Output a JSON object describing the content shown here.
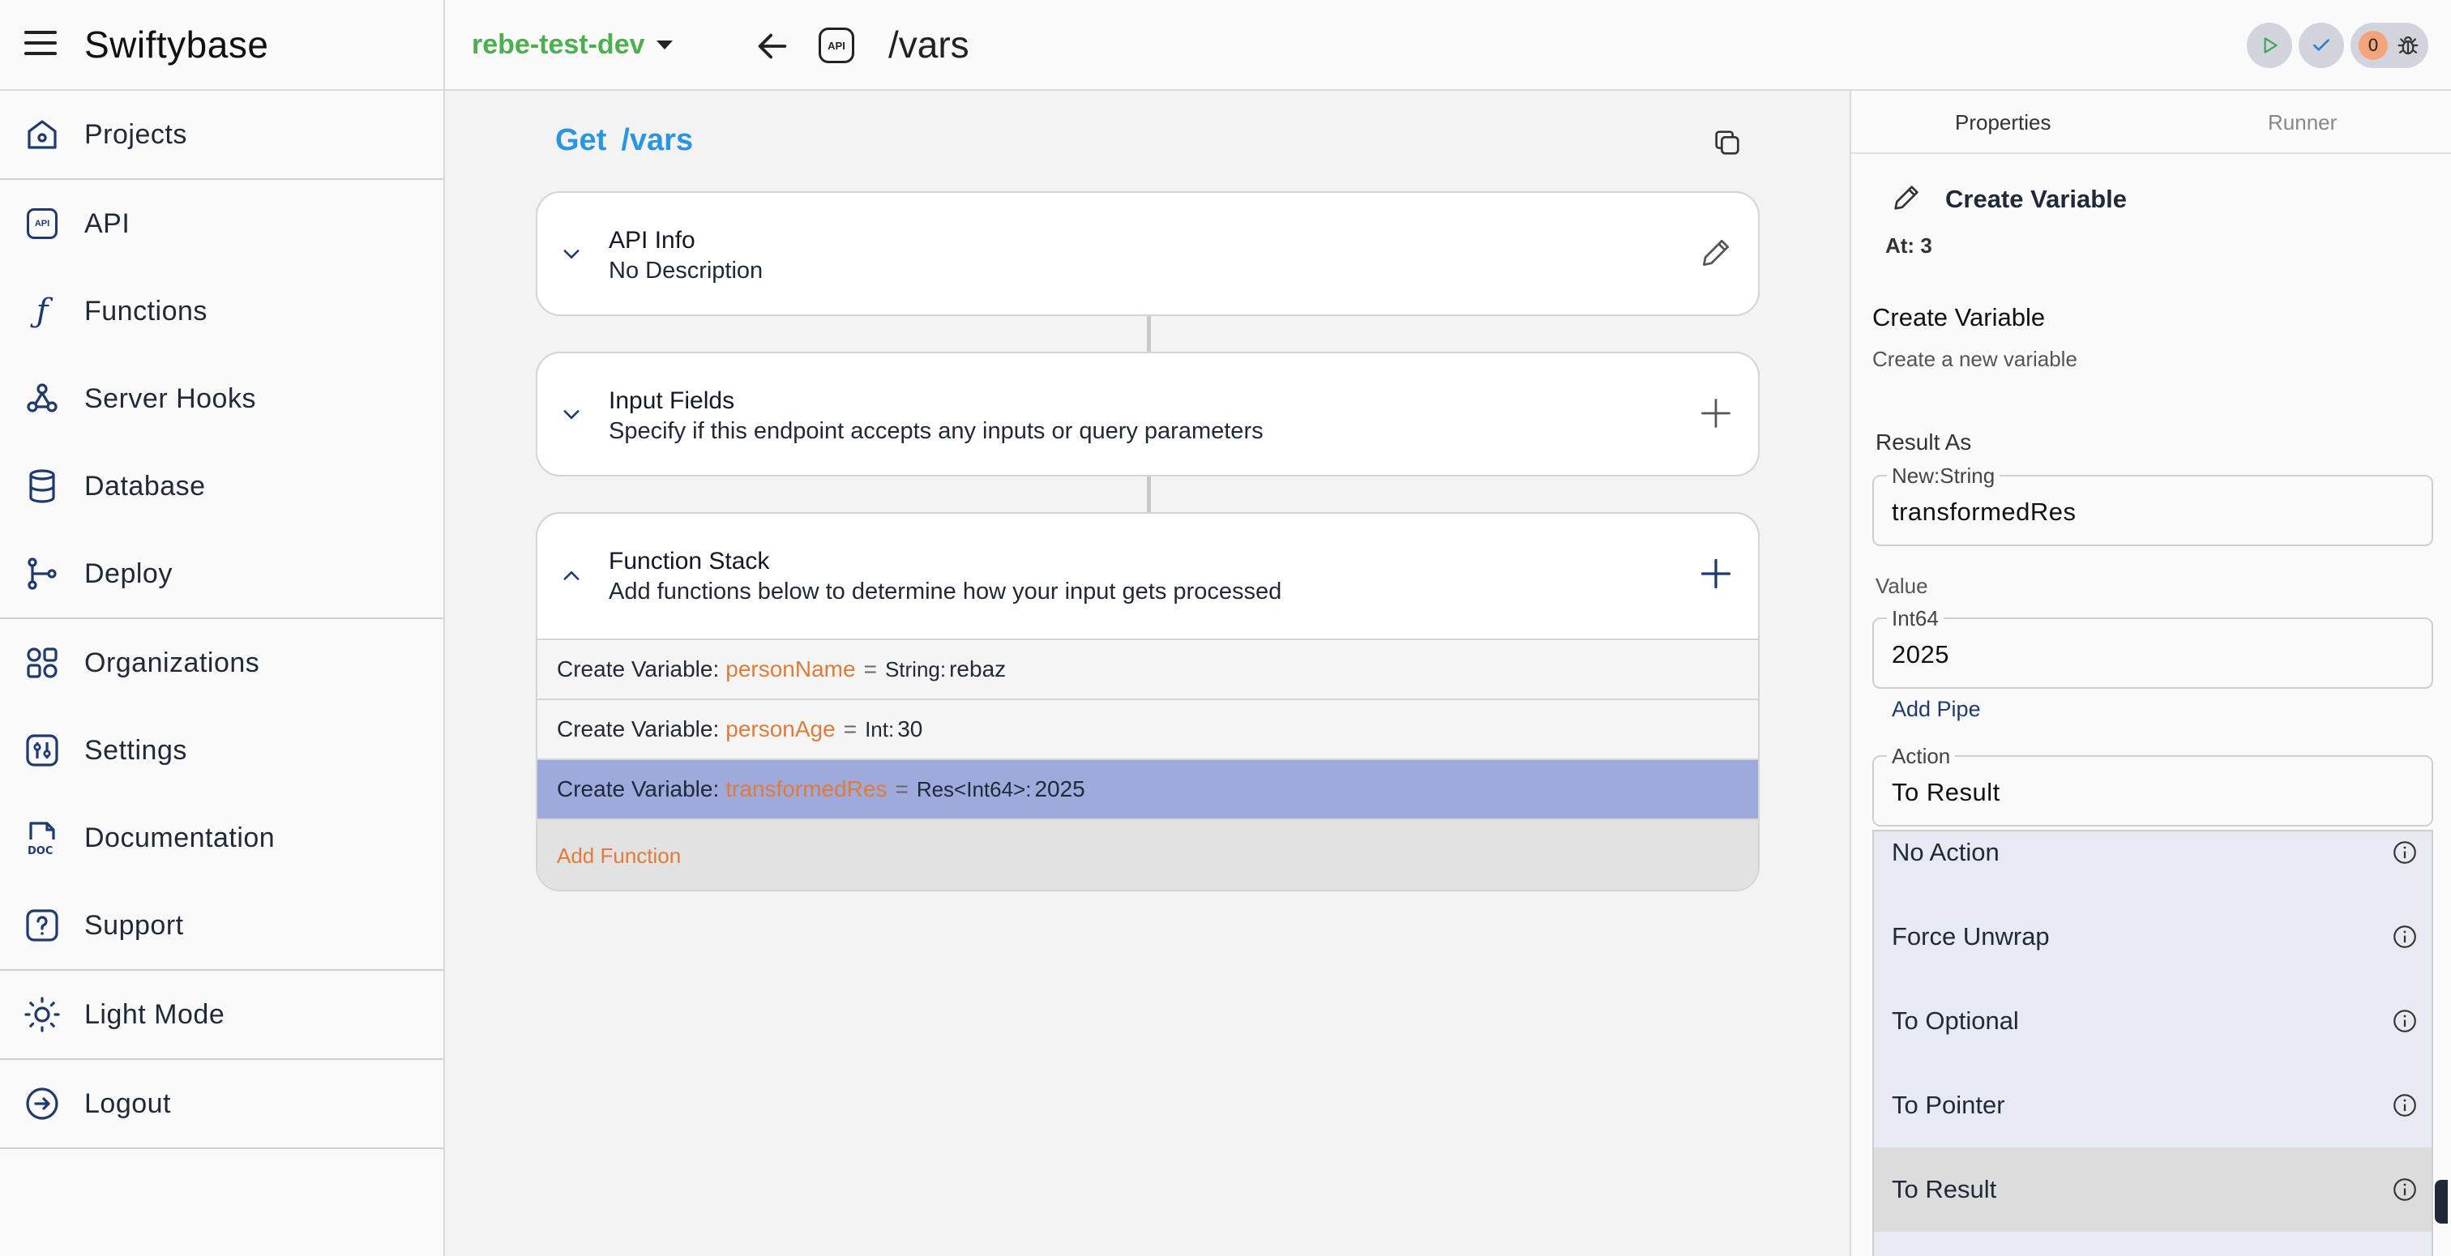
{
  "app": {
    "brand": "Swiftybase",
    "project": "rebe-test-dev",
    "route_badge": "API",
    "route": "/vars",
    "issue_count": "0"
  },
  "sidebar": {
    "items": [
      {
        "label": "Projects",
        "icon": "home-icon"
      },
      {
        "label": "API",
        "icon": "api-icon"
      },
      {
        "label": "Functions",
        "icon": "function-icon"
      },
      {
        "label": "Server Hooks",
        "icon": "webhook-icon"
      },
      {
        "label": "Database",
        "icon": "database-icon"
      },
      {
        "label": "Deploy",
        "icon": "git-branch-icon"
      },
      {
        "label": "Organizations",
        "icon": "shapes-icon"
      },
      {
        "label": "Settings",
        "icon": "settings-icon"
      },
      {
        "label": "Documentation",
        "icon": "doc-icon"
      },
      {
        "label": "Support",
        "icon": "help-icon"
      },
      {
        "label": "Light Mode",
        "icon": "sun-icon"
      },
      {
        "label": "Logout",
        "icon": "logout-icon"
      }
    ]
  },
  "main": {
    "method": "Get",
    "path": "/vars",
    "api_info": {
      "title": "API Info",
      "description": "No Description"
    },
    "input_fields": {
      "title": "Input Fields",
      "description": "Specify if this endpoint accepts any inputs or query parameters"
    },
    "function_stack": {
      "title": "Function Stack",
      "description": "Add functions below to determine how your input gets processed",
      "rows": [
        {
          "prefix": "Create Variable:",
          "name": "personName",
          "eq": "=",
          "type": "String:",
          "value": "rebaz"
        },
        {
          "prefix": "Create Variable:",
          "name": "personAge",
          "eq": "=",
          "type": "Int:",
          "value": "30"
        },
        {
          "prefix": "Create Variable:",
          "name": "transformedRes",
          "eq": "=",
          "type": "Res<Int64>:",
          "value": "2025"
        }
      ],
      "add_label": "Add Function"
    }
  },
  "panel": {
    "tabs": [
      "Properties",
      "Runner"
    ],
    "header_title": "Create Variable",
    "at": "At: 3",
    "section_title": "Create Variable",
    "section_sub": "Create a new variable",
    "result_as_label": "Result As",
    "result_legend": "New:String",
    "result_value": "transformedRes",
    "value_label": "Value",
    "value_legend": "Int64",
    "value_value": "2025",
    "add_pipe": "Add Pipe",
    "action_legend": "Action",
    "action_value": "To Result",
    "options": [
      "No Action",
      "Force Unwrap",
      "To Optional",
      "To Pointer",
      "To Result"
    ]
  },
  "colors": {
    "accent_blue": "#2b95dd",
    "project_green": "#4caf50",
    "var_orange": "#e07b39",
    "selected_row": "#9ea9dc"
  }
}
